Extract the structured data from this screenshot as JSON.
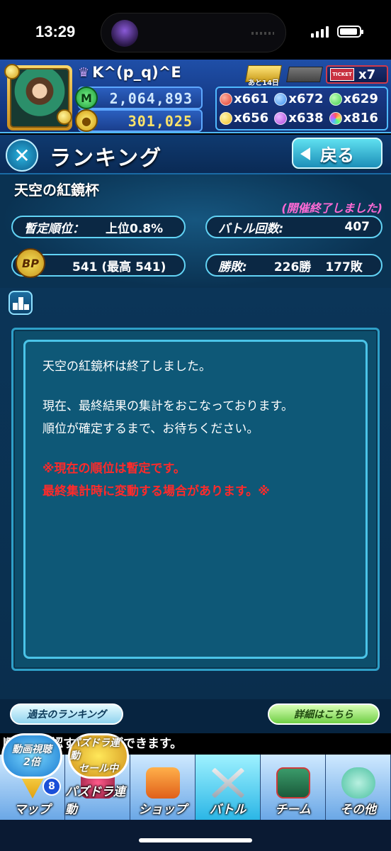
{
  "status_bar": {
    "time": "13:29"
  },
  "player": {
    "name": "K^(p_q)^E",
    "monster_points": "2,064,893",
    "coins": "301,025",
    "ticket_days": "あと14日",
    "ticket_label": "TICKET",
    "ticket_count": "x7"
  },
  "orbs": [
    {
      "color": "#e23a2a",
      "value": "x661"
    },
    {
      "color": "#3a8ef0",
      "value": "x672"
    },
    {
      "color": "#3fcf4a",
      "value": "x629"
    },
    {
      "color": "#f0c020",
      "value": "x656"
    },
    {
      "color": "#b04adc",
      "value": "x638"
    },
    {
      "color": "#ff7ad0",
      "value": "x816"
    }
  ],
  "title": {
    "text": "ランキング",
    "back_label": "戻る"
  },
  "event": {
    "name": "天空の紅鏡杯",
    "status": "(開催終了しました)",
    "rank_label": "暫定順位：",
    "rank_value": "上位0.8%",
    "battles_label": "バトル回数:",
    "battles_value": "407",
    "bp_icon": "BP",
    "bp_value": "541 (最高 541)",
    "winloss_label": "勝敗:",
    "wins": "226勝",
    "losses": "177敗"
  },
  "message": {
    "line1": "天空の紅鏡杯は終了しました。",
    "line2": "現在、最終結果の集計をおこなっております。",
    "line3": "順位が確定するまで、お待ちください。",
    "warn1": "※現在の順位は暫定です。",
    "warn2": "最終集計時に変動する場合があります。※"
  },
  "buttons": {
    "past_rankings": "過去のランキング",
    "details": "詳細はこちら"
  },
  "ticker": "順位を確認することができます。",
  "bubbles": {
    "video_line1": "動画視聴",
    "video_line2": "2倍",
    "sale_line1": "パズドラ連動",
    "sale_line2": "セール中"
  },
  "nav": {
    "badge": "8",
    "items": [
      {
        "label": "マップ",
        "icon": "map-icon"
      },
      {
        "label": "パズドラ連動",
        "icon": "dragon-icon"
      },
      {
        "label": "ショップ",
        "icon": "shop-bag-icon"
      },
      {
        "label": "バトル",
        "icon": "crossed-swords-icon"
      },
      {
        "label": "チーム",
        "icon": "team-icon"
      },
      {
        "label": "その他",
        "icon": "question-icon"
      }
    ]
  }
}
